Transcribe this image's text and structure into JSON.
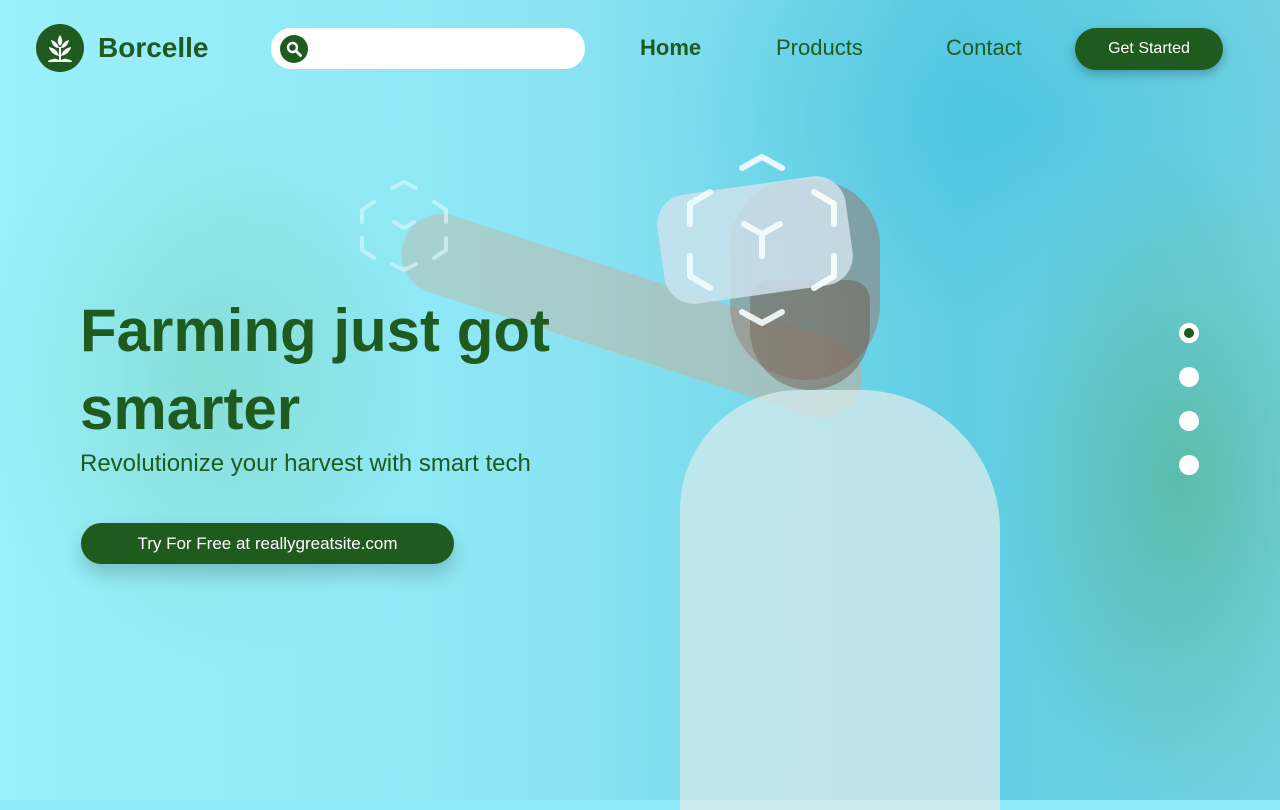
{
  "brand": {
    "name": "Borcelle",
    "icon": "leaf-icon",
    "color": "#1f5a1e"
  },
  "search": {
    "placeholder": "",
    "value": "",
    "icon": "search-icon"
  },
  "nav": {
    "items": [
      {
        "label": "Home",
        "active": true
      },
      {
        "label": "Products",
        "active": false
      },
      {
        "label": "Contact",
        "active": false
      }
    ],
    "cta_label": "Get Started"
  },
  "hero": {
    "headline": "Farming just got smarter",
    "subheadline": "Revolutionize your harvest with smart tech",
    "cta_label": "Try For Free at reallygreatsite.com"
  },
  "carousel": {
    "slide_count": 4,
    "active_index": 0
  },
  "colors": {
    "accent": "#1f5a1e",
    "background": "#8eeaf6",
    "button_text": "#ffffff"
  }
}
